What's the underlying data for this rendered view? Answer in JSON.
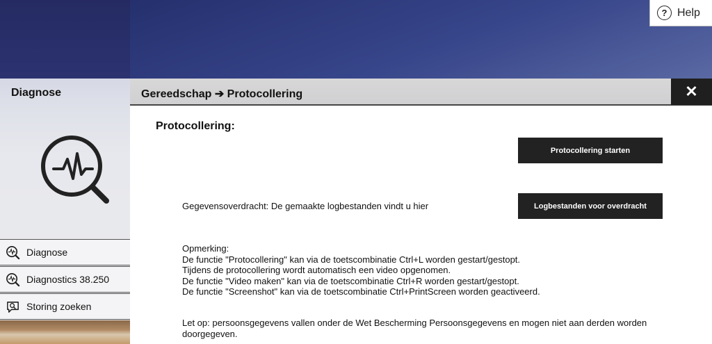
{
  "help": {
    "label": "Help",
    "icon": "question-circle-icon"
  },
  "sidebar": {
    "title": "Diagnose",
    "illustration_icon": "magnifier-heartbeat-icon",
    "items": [
      {
        "label": "Diagnose",
        "icon": "magnifier-heartbeat-icon"
      },
      {
        "label": "Diagnostics 38.250",
        "icon": "magnifier-heartbeat-icon"
      },
      {
        "label": "Storing zoeken",
        "icon": "speech-bubble-search-icon"
      }
    ]
  },
  "panel": {
    "breadcrumb": "Gereedschap ➔ Protocollering",
    "close_icon": "close-icon"
  },
  "content": {
    "section_title": "Protocollering:",
    "start_button": "Protocollering starten",
    "transfer_text": "Gegevensoverdracht: De gemaakte logbestanden vindt u hier",
    "logs_button": "Logbestanden voor overdracht",
    "remark_lines": [
      "Opmerking:",
      "De functie \"Protocollering\" kan via de toetscombinatie Ctrl+L worden gestart/gestopt.",
      "Tijdens de protocollering wordt automatisch een video opgenomen.",
      "De functie \"Video maken\" kan via de toetscombinatie Ctrl+R worden gestart/gestopt.",
      "De functie \"Screenshot\" kan via de toetscombinatie Ctrl+PrintScreen worden geactiveerd."
    ],
    "warning": "Let op: persoonsgegevens vallen onder de Wet Bescherming Persoonsgegevens en mogen niet aan derden worden doorgegeven."
  },
  "colors": {
    "header_dark": "#222222",
    "background_blue": "#2b3270"
  }
}
